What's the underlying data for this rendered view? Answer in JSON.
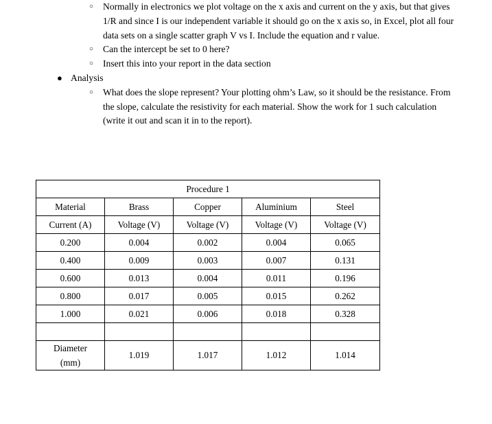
{
  "document": {
    "outline": [
      {
        "level": 2,
        "bullet": "hollow-circle",
        "text": "Normally in electronics we plot voltage on the x axis and current on the y axis, but that gives 1/R and since I is our independent variable it should go on the x axis so, in Excel, plot all four data sets on a single scatter graph V vs I. Include the equation and r value."
      },
      {
        "level": 2,
        "bullet": "hollow-circle",
        "text": "Can the intercept be set to 0 here?"
      },
      {
        "level": 2,
        "bullet": "hollow-circle",
        "text": "Insert this into your report in the data section"
      },
      {
        "level": 1,
        "bullet": "filled-circle",
        "text": "Analysis"
      },
      {
        "level": 2,
        "bullet": "hollow-circle",
        "text": "What does the slope represent? Your plotting ohm’s Law, so it should be the resistance. From the slope, calculate the resistivity for each material. Show the work for 1 such calculation (write it out and scan it in to the report)."
      }
    ],
    "bullet_glyphs": {
      "hollow-circle": "○",
      "filled-circle": "●"
    }
  },
  "table": {
    "title": "Procedure 1",
    "material_row": [
      "Material",
      "Brass",
      "Copper",
      "Aluminium",
      "Steel"
    ],
    "unit_row": [
      "Current (A)",
      "Voltage (V)",
      "Voltage (V)",
      "Voltage (V)",
      "Voltage (V)"
    ],
    "data_rows": [
      [
        "0.200",
        "0.004",
        "0.002",
        "0.004",
        "0.065"
      ],
      [
        "0.400",
        "0.009",
        "0.003",
        "0.007",
        "0.131"
      ],
      [
        "0.600",
        "0.013",
        "0.004",
        "0.011",
        "0.196"
      ],
      [
        "0.800",
        "0.017",
        "0.005",
        "0.015",
        "0.262"
      ],
      [
        "1.000",
        "0.021",
        "0.006",
        "0.018",
        "0.328"
      ]
    ],
    "spacer_row": [
      "",
      "",
      "",
      "",
      ""
    ],
    "diameter_row": {
      "label_line1": "Diameter",
      "label_line2": "(mm)",
      "values": [
        "1.019",
        "1.017",
        "1.012",
        "1.014"
      ]
    }
  }
}
